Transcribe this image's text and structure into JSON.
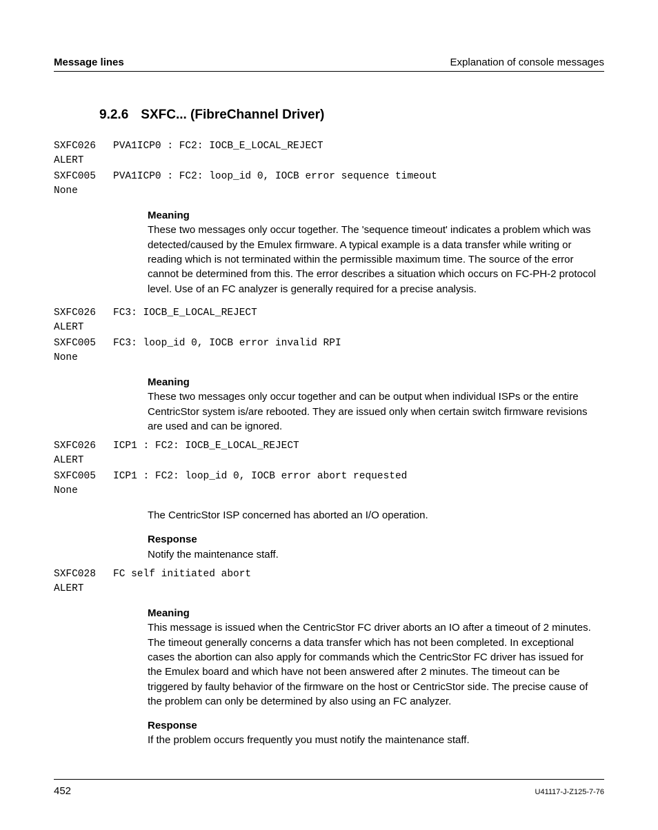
{
  "header": {
    "left": "Message lines",
    "right": "Explanation of console messages"
  },
  "section": {
    "number": "9.2.6",
    "title": "SXFC... (FibreChannel Driver)"
  },
  "msg1": {
    "line1_code": "SXFC026\nALERT",
    "line1_text": "PVA1ICP0 : FC2: IOCB_E_LOCAL_REJECT",
    "line2_code": "SXFC005\nNone",
    "line2_text": "PVA1ICP0 : FC2: loop_id 0, IOCB error sequence timeout",
    "meaning_head": "Meaning",
    "meaning_body": "These two messages only occur together. The 'sequence timeout' indicates a problem which was detected/caused by the Emulex firmware. A typical example is a data transfer while writing or reading which is not terminated within the permissible maximum time. The source of the error cannot be determined from this. The error describes a situation which occurs on FC-PH-2 protocol level. Use of an FC analyzer is generally required for a precise analysis."
  },
  "msg2": {
    "line1_code": "SXFC026\nALERT",
    "line1_text": "FC3: IOCB_E_LOCAL_REJECT",
    "line2_code": "SXFC005\nNone",
    "line2_text": "FC3: loop_id 0, IOCB error invalid RPI",
    "meaning_head": "Meaning",
    "meaning_body": "These two messages only occur together and can be output when individual ISPs or the entire CentricStor system is/are rebooted. They are issued only when certain switch firmware revisions are used and can be ignored."
  },
  "msg3": {
    "line1_code": "SXFC026\nALERT",
    "line1_text": "ICP1 : FC2: IOCB_E_LOCAL_REJECT",
    "line2_code": "SXFC005\nNone",
    "line2_text": "ICP1 : FC2: loop_id 0, IOCB error abort requested",
    "body1": "The CentricStor ISP concerned has aborted an I/O operation.",
    "response_head": "Response",
    "response_body": "Notify the maintenance staff."
  },
  "msg4": {
    "line1_code": "SXFC028\nALERT",
    "line1_text": "FC self initiated abort",
    "meaning_head": "Meaning",
    "meaning_body": "This message is issued when the CentricStor FC driver aborts an IO after a timeout of 2 minutes. The timeout generally concerns a data transfer which has not been completed. In exceptional cases the abortion can also apply for commands which the CentricStor FC driver has issued for the Emulex board and which have not been answered after 2 minutes. The timeout can be triggered by faulty behavior of the firmware on the host or CentricStor side. The precise cause of the problem can only be determined by also using an FC analyzer.",
    "response_head": "Response",
    "response_body": "If the problem occurs frequently you must notify the maintenance staff."
  },
  "footer": {
    "page": "452",
    "docid": "U41117-J-Z125-7-76"
  }
}
